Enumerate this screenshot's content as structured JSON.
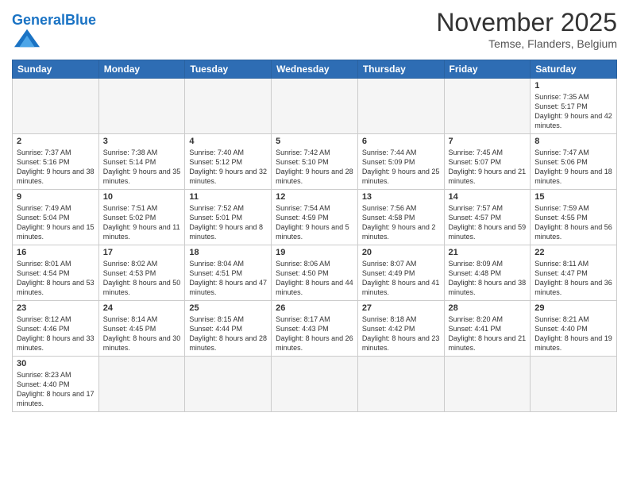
{
  "logo": {
    "general": "General",
    "blue": "Blue"
  },
  "header": {
    "month": "November 2025",
    "location": "Temse, Flanders, Belgium"
  },
  "weekdays": [
    "Sunday",
    "Monday",
    "Tuesday",
    "Wednesday",
    "Thursday",
    "Friday",
    "Saturday"
  ],
  "weeks": [
    [
      {
        "day": "",
        "info": ""
      },
      {
        "day": "",
        "info": ""
      },
      {
        "day": "",
        "info": ""
      },
      {
        "day": "",
        "info": ""
      },
      {
        "day": "",
        "info": ""
      },
      {
        "day": "",
        "info": ""
      },
      {
        "day": "1",
        "info": "Sunrise: 7:35 AM\nSunset: 5:17 PM\nDaylight: 9 hours and 42 minutes."
      }
    ],
    [
      {
        "day": "2",
        "info": "Sunrise: 7:37 AM\nSunset: 5:16 PM\nDaylight: 9 hours and 38 minutes."
      },
      {
        "day": "3",
        "info": "Sunrise: 7:38 AM\nSunset: 5:14 PM\nDaylight: 9 hours and 35 minutes."
      },
      {
        "day": "4",
        "info": "Sunrise: 7:40 AM\nSunset: 5:12 PM\nDaylight: 9 hours and 32 minutes."
      },
      {
        "day": "5",
        "info": "Sunrise: 7:42 AM\nSunset: 5:10 PM\nDaylight: 9 hours and 28 minutes."
      },
      {
        "day": "6",
        "info": "Sunrise: 7:44 AM\nSunset: 5:09 PM\nDaylight: 9 hours and 25 minutes."
      },
      {
        "day": "7",
        "info": "Sunrise: 7:45 AM\nSunset: 5:07 PM\nDaylight: 9 hours and 21 minutes."
      },
      {
        "day": "8",
        "info": "Sunrise: 7:47 AM\nSunset: 5:06 PM\nDaylight: 9 hours and 18 minutes."
      }
    ],
    [
      {
        "day": "9",
        "info": "Sunrise: 7:49 AM\nSunset: 5:04 PM\nDaylight: 9 hours and 15 minutes."
      },
      {
        "day": "10",
        "info": "Sunrise: 7:51 AM\nSunset: 5:02 PM\nDaylight: 9 hours and 11 minutes."
      },
      {
        "day": "11",
        "info": "Sunrise: 7:52 AM\nSunset: 5:01 PM\nDaylight: 9 hours and 8 minutes."
      },
      {
        "day": "12",
        "info": "Sunrise: 7:54 AM\nSunset: 4:59 PM\nDaylight: 9 hours and 5 minutes."
      },
      {
        "day": "13",
        "info": "Sunrise: 7:56 AM\nSunset: 4:58 PM\nDaylight: 9 hours and 2 minutes."
      },
      {
        "day": "14",
        "info": "Sunrise: 7:57 AM\nSunset: 4:57 PM\nDaylight: 8 hours and 59 minutes."
      },
      {
        "day": "15",
        "info": "Sunrise: 7:59 AM\nSunset: 4:55 PM\nDaylight: 8 hours and 56 minutes."
      }
    ],
    [
      {
        "day": "16",
        "info": "Sunrise: 8:01 AM\nSunset: 4:54 PM\nDaylight: 8 hours and 53 minutes."
      },
      {
        "day": "17",
        "info": "Sunrise: 8:02 AM\nSunset: 4:53 PM\nDaylight: 8 hours and 50 minutes."
      },
      {
        "day": "18",
        "info": "Sunrise: 8:04 AM\nSunset: 4:51 PM\nDaylight: 8 hours and 47 minutes."
      },
      {
        "day": "19",
        "info": "Sunrise: 8:06 AM\nSunset: 4:50 PM\nDaylight: 8 hours and 44 minutes."
      },
      {
        "day": "20",
        "info": "Sunrise: 8:07 AM\nSunset: 4:49 PM\nDaylight: 8 hours and 41 minutes."
      },
      {
        "day": "21",
        "info": "Sunrise: 8:09 AM\nSunset: 4:48 PM\nDaylight: 8 hours and 38 minutes."
      },
      {
        "day": "22",
        "info": "Sunrise: 8:11 AM\nSunset: 4:47 PM\nDaylight: 8 hours and 36 minutes."
      }
    ],
    [
      {
        "day": "23",
        "info": "Sunrise: 8:12 AM\nSunset: 4:46 PM\nDaylight: 8 hours and 33 minutes."
      },
      {
        "day": "24",
        "info": "Sunrise: 8:14 AM\nSunset: 4:45 PM\nDaylight: 8 hours and 30 minutes."
      },
      {
        "day": "25",
        "info": "Sunrise: 8:15 AM\nSunset: 4:44 PM\nDaylight: 8 hours and 28 minutes."
      },
      {
        "day": "26",
        "info": "Sunrise: 8:17 AM\nSunset: 4:43 PM\nDaylight: 8 hours and 26 minutes."
      },
      {
        "day": "27",
        "info": "Sunrise: 8:18 AM\nSunset: 4:42 PM\nDaylight: 8 hours and 23 minutes."
      },
      {
        "day": "28",
        "info": "Sunrise: 8:20 AM\nSunset: 4:41 PM\nDaylight: 8 hours and 21 minutes."
      },
      {
        "day": "29",
        "info": "Sunrise: 8:21 AM\nSunset: 4:40 PM\nDaylight: 8 hours and 19 minutes."
      }
    ],
    [
      {
        "day": "30",
        "info": "Sunrise: 8:23 AM\nSunset: 4:40 PM\nDaylight: 8 hours and 17 minutes."
      },
      {
        "day": "",
        "info": ""
      },
      {
        "day": "",
        "info": ""
      },
      {
        "day": "",
        "info": ""
      },
      {
        "day": "",
        "info": ""
      },
      {
        "day": "",
        "info": ""
      },
      {
        "day": "",
        "info": ""
      }
    ]
  ]
}
